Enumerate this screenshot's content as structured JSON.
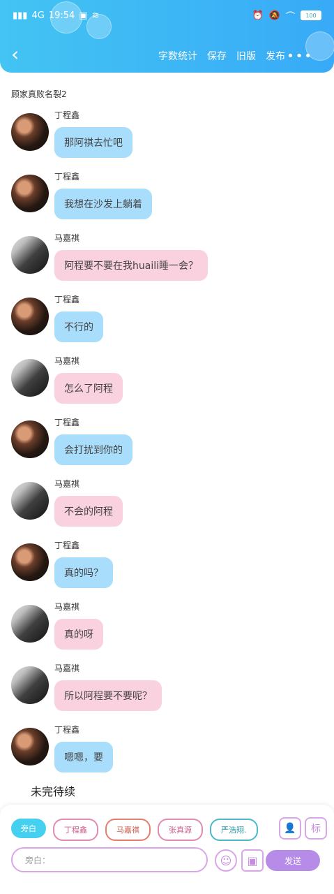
{
  "status": {
    "network": "4G",
    "time": "19:54",
    "battery": "100"
  },
  "nav": {
    "back_icon": "chevron-left-icon",
    "actions": [
      "字数统计",
      "保存",
      "旧版",
      "发布"
    ],
    "more": "•••"
  },
  "doc_title": "顾家真败名裂2",
  "messages": [
    {
      "name": "丁程鑫",
      "text": "那阿祺去忙吧",
      "color": "blue"
    },
    {
      "name": "丁程鑫",
      "text": "我想在沙发上躺着",
      "color": "blue"
    },
    {
      "name": "马嘉祺",
      "text": "阿程要不要在我huaili睡一会？",
      "color": "pink"
    },
    {
      "name": "丁程鑫",
      "text": "不行的",
      "color": "blue"
    },
    {
      "name": "马嘉祺",
      "text": "怎么了阿程",
      "color": "pink"
    },
    {
      "name": "丁程鑫",
      "text": "会打扰到你的",
      "color": "blue"
    },
    {
      "name": "马嘉祺",
      "text": "不会的阿程",
      "color": "pink"
    },
    {
      "name": "丁程鑫",
      "text": "真的吗？",
      "color": "blue"
    },
    {
      "name": "马嘉祺",
      "text": "真的呀",
      "color": "pink"
    },
    {
      "name": "马嘉祺",
      "text": "所以阿程要不要呢？",
      "color": "pink"
    },
    {
      "name": "丁程鑫",
      "text": "嗯嗯，要",
      "color": "blue"
    }
  ],
  "closing_text": "未完待续",
  "composer": {
    "chips": [
      {
        "label": "旁白",
        "selected": true,
        "color": "#46d0ef"
      },
      {
        "label": "丁程鑫",
        "selected": false,
        "color": "#e38bb0"
      },
      {
        "label": "马嘉祺",
        "selected": false,
        "color": "#e57e6f"
      },
      {
        "label": "张真源",
        "selected": false,
        "color": "#e38bb0"
      },
      {
        "label": "严浩翔.",
        "selected": false,
        "color": "#4bb9c9"
      }
    ],
    "tool_icons": [
      "person-icon",
      "label-icon"
    ],
    "label_tool_text": "标",
    "placeholder": "旁白：",
    "emoji_icon": "smile-icon",
    "image_icon": "image-icon",
    "send_label": "发送"
  },
  "colors": {
    "header_start": "#43c4f3",
    "header_end": "#38aaf7",
    "bubble_blue": "#a9ddfc",
    "bubble_pink": "#fad1de",
    "accent_purple": "#b68ce8"
  }
}
